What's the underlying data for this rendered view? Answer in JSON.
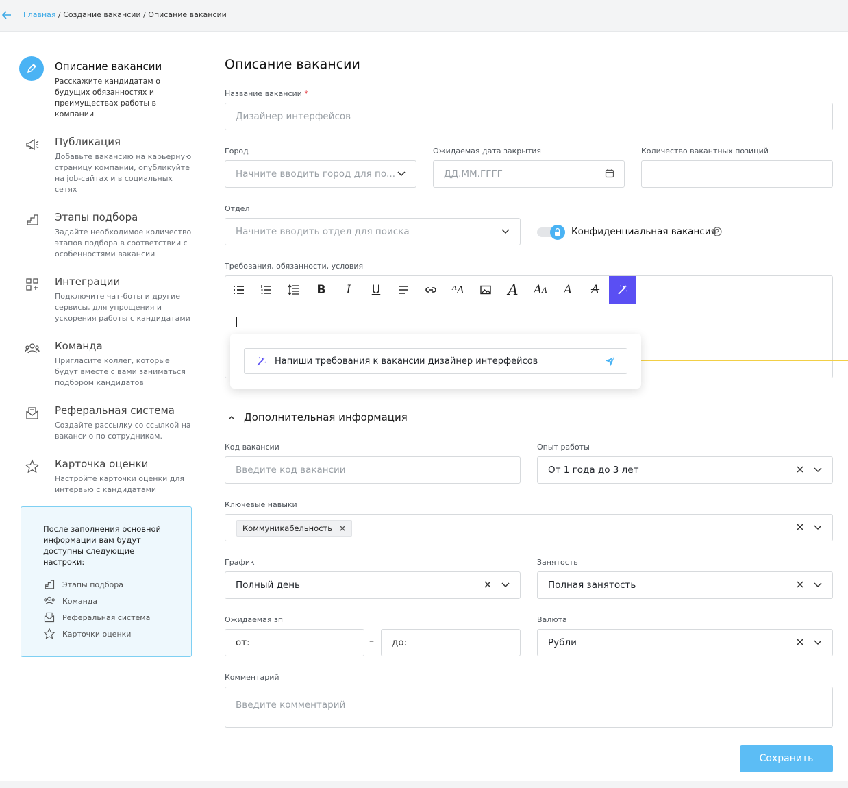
{
  "breadcrumb": {
    "home": "Главная",
    "sep1": " / ",
    "create": "Создание вакансии",
    "sep2": " / ",
    "current": "Описание вакансии"
  },
  "sidebar": {
    "steps": [
      {
        "title": "Описание вакансии",
        "desc": "Расскажите кандидатам о будущих обязанностях и преимуществах работы в компании",
        "icon": "pencil-icon"
      },
      {
        "title": "Публикация",
        "desc": "Добавьте вакансию на карьерную страницу компании, опубликуйте на job-сайтах и в социальных сетях",
        "icon": "megaphone-icon"
      },
      {
        "title": "Этапы подбора",
        "desc": "Задайте необходимое количество этапов подбора в соответствии с особенностями вакансии",
        "icon": "stairs-icon"
      },
      {
        "title": "Интеграции",
        "desc": "Подключите чат-боты и другие сервисы, для упрощения и ускорения работы с кандидатами",
        "icon": "grid-plus-icon"
      },
      {
        "title": "Команда",
        "desc": "Пригласите коллег, которые будут вместе с вами заниматься подбором кандидатов",
        "icon": "team-icon"
      },
      {
        "title": "Реферальная система",
        "desc": "Создайте рассылку со ссылкой на вакансию по сотрудникам.",
        "icon": "mail-icon"
      },
      {
        "title": "Карточка оценки",
        "desc": "Настройте карточки оценки для интервью с кандидатами",
        "icon": "star-icon"
      }
    ],
    "info": {
      "text": "После заполнения основной информации вам будут доступны следующие настроки:",
      "items": [
        "Этапы подбора",
        "Команда",
        "Реферальная система",
        "Карточки оценки"
      ]
    }
  },
  "main": {
    "title": "Описание вакансии",
    "vacancy_name": {
      "label": "Название вакансии",
      "required": "*",
      "placeholder": "Дизайнер интерфейсов"
    },
    "city": {
      "label": "Город",
      "placeholder": "Начните вводить город для по..."
    },
    "close_date": {
      "label": "Ожидаемая дата закрытия",
      "placeholder": "ДД.ММ.ГГГГ"
    },
    "positions": {
      "label": "Количество вакантных позиций",
      "value": ""
    },
    "department": {
      "label": "Отдел",
      "placeholder": "Начните вводить отдел для поиска"
    },
    "confidential": {
      "label": "Конфиденциальная вакансия",
      "enabled": false
    },
    "requirements": {
      "label": "Требования, обязанности, условия"
    },
    "ai_prompt": {
      "value": "Напиши требования к вакансии дизайнер интерфейсов"
    },
    "additional": {
      "title": "Дополнительная информация"
    },
    "code": {
      "label": "Код вакансии",
      "placeholder": "Введите код вакансии"
    },
    "experience": {
      "label": "Опыт работы",
      "value": "От 1 года до 3 лет"
    },
    "skills": {
      "label": "Ключевые навыки",
      "chips": [
        "Коммуникабельность"
      ]
    },
    "schedule": {
      "label": "График",
      "value": "Полный день"
    },
    "employment": {
      "label": "Занятость",
      "value": "Полная занятость"
    },
    "salary": {
      "label": "Ожидаемая зп",
      "from_placeholder": "от:",
      "to_placeholder": "до:",
      "dash": "–"
    },
    "currency": {
      "label": "Валюта",
      "value": "Рубли"
    },
    "comment": {
      "label": "Комментарий",
      "placeholder": "Введите комментарий"
    },
    "save_label": "Сохранить"
  },
  "colors": {
    "accent": "#4ab3f4",
    "ai": "#5a4ff3",
    "save": "#5cbdf5",
    "highlight": "#f2cf46"
  }
}
